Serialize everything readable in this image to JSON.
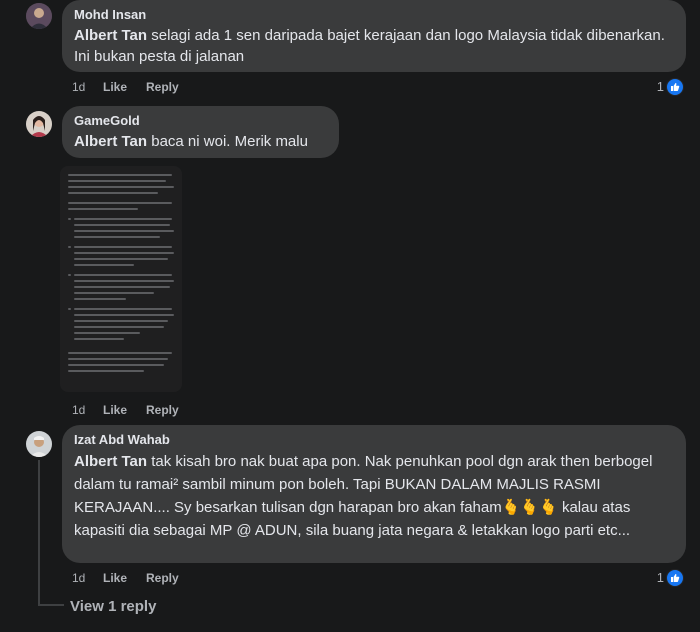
{
  "comments": [
    {
      "author": "Mohd Insan",
      "mention": "Albert Tan",
      "text": " selagi ada 1 sen daripada bajet kerajaan dan logo Malaysia tidak dibenarkan. Ini bukan pesta di jalanan",
      "time": "1d",
      "like": "Like",
      "reply": "Reply",
      "reaction_count": "1"
    },
    {
      "author": "GameGold",
      "mention": "Albert Tan",
      "text": " baca ni woi. Merik malu",
      "time": "1d",
      "like": "Like",
      "reply": "Reply",
      "attachment": "screenshot-image"
    },
    {
      "author": "Izat Abd Wahab",
      "mention": "Albert Tan",
      "text": " tak kisah bro nak buat apa pon. Nak penuhkan pool dgn arak then berbogel dalam tu ramai² sambil minum pon boleh. Tapi BUKAN DALAM MAJLIS RASMI KERAJAAN.... Sy besarkan tulisan dgn harapan bro akan faham🫰🫰🫰 kalau atas kapasiti dia sebagai MP @ ADUN, sila buang jata negara & letakkan logo parti etc...",
      "time": "1d",
      "like": "Like",
      "reply": "Reply",
      "reaction_count": "1"
    }
  ],
  "view_replies": "View 1 reply",
  "colors": {
    "background": "#18191a",
    "bubble": "#3a3b3c",
    "text": "#e4e6eb",
    "muted": "#b0b3b8",
    "like_blue": "#1877f2"
  }
}
